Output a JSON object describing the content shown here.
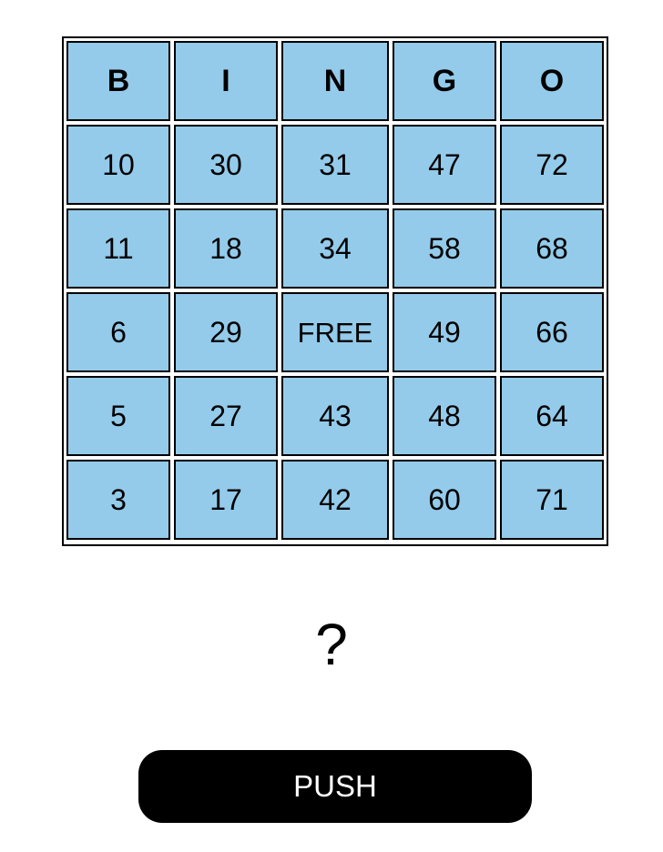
{
  "board": {
    "headers": [
      "B",
      "I",
      "N",
      "G",
      "O"
    ],
    "rows": [
      [
        "10",
        "30",
        "31",
        "47",
        "72"
      ],
      [
        "11",
        "18",
        "34",
        "58",
        "68"
      ],
      [
        "6",
        "29",
        "FREE",
        "49",
        "66"
      ],
      [
        "5",
        "27",
        "43",
        "48",
        "64"
      ],
      [
        "3",
        "17",
        "42",
        "60",
        "71"
      ]
    ]
  },
  "current_number": "?",
  "push_button_label": "PUSH",
  "colors": {
    "cell_fill": "#94cbea",
    "border": "#000000",
    "button_fill": "#000000",
    "button_text": "#ffffff"
  }
}
